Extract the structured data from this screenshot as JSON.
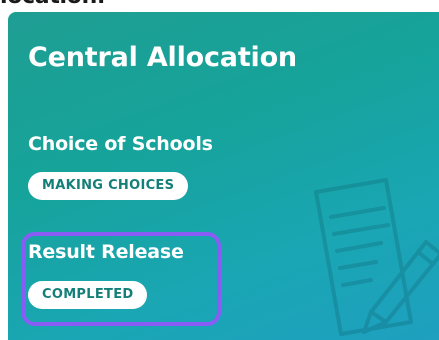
{
  "page": {
    "cut_text": "location."
  },
  "card": {
    "title": "Central Allocation",
    "sections": [
      {
        "title": "Choice of Schools",
        "status": "MAKING CHOICES"
      },
      {
        "title": "Result Release",
        "status": "COMPLETED"
      }
    ],
    "icon": "document-pencil-icon"
  },
  "colors": {
    "gradient_start": "#1f9e93",
    "gradient_end": "#1e9fc0",
    "highlight": "#8a5cf6",
    "badge_text": "#147f78"
  }
}
